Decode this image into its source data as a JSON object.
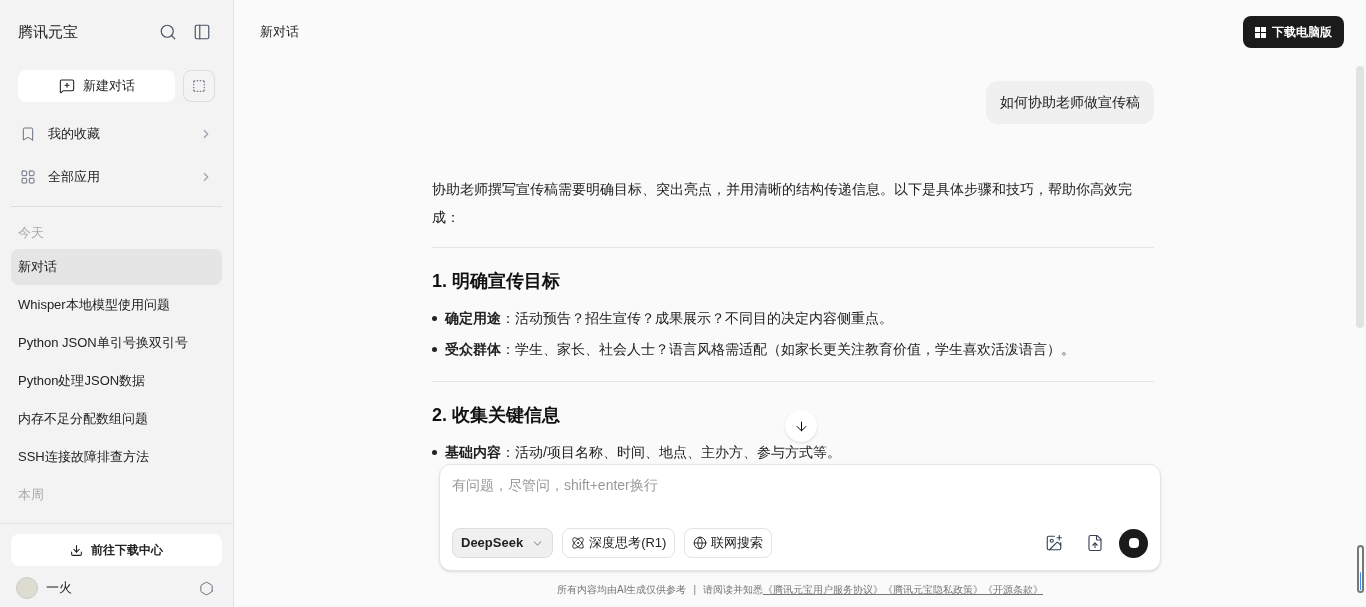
{
  "sidebar": {
    "app_title": "腾讯元宝",
    "new_chat_button": "新建对话",
    "nav_items": [
      {
        "label": "我的收藏",
        "kind": "bookmark"
      },
      {
        "label": "全部应用",
        "kind": "apps"
      }
    ],
    "history_groups": [
      {
        "label": "今天",
        "items": [
          {
            "title": "新对话",
            "selected": true
          },
          {
            "title": "Whisper本地模型使用问题",
            "selected": false
          },
          {
            "title": "Python JSON单引号换双引号",
            "selected": false
          },
          {
            "title": "Python处理JSON数据",
            "selected": false
          },
          {
            "title": "内存不足分配数组问题",
            "selected": false
          },
          {
            "title": "SSH连接故障排查方法",
            "selected": false
          }
        ]
      },
      {
        "label": "本周"
      }
    ],
    "download_center_button": "前往下载中心",
    "user": {
      "name": "一火"
    }
  },
  "header": {
    "title": "新对话",
    "download_button": "下载电脑版"
  },
  "chat": {
    "user_message": "如何协助老师做宣传稿",
    "answer": [
      {
        "kind": "paragraph",
        "text": "协助老师撰写宣传稿需要明确目标、突出亮点，并用清晰的结构传递信息。以下是具体步骤和技巧，帮助你高效完成："
      },
      {
        "kind": "divider"
      },
      {
        "kind": "heading",
        "text": "1. 明确宣传目标"
      },
      {
        "kind": "bullets",
        "items": [
          "**确定用途**：活动预告？招生宣传？成果展示？不同目的决定内容侧重点。",
          "**受众群体**：学生、家长、社会人士？语言风格需适配（如家长更关注教育价值，学生喜欢活泼语言）。"
        ]
      },
      {
        "kind": "divider"
      },
      {
        "kind": "heading",
        "text": "2. 收集关键信息"
      },
      {
        "kind": "bullets",
        "items": [
          "**基础内容**：活动/项目名称、时间、地点、主办方、参与方式等。"
        ]
      }
    ]
  },
  "composer": {
    "placeholder": "有问题，尽管问，shift+enter换行",
    "model": "DeepSeek",
    "toggles": [
      {
        "label": "深度思考(R1)",
        "kind": "think",
        "selected": false
      },
      {
        "label": "联网搜索",
        "kind": "web",
        "selected": false
      }
    ]
  },
  "footer": {
    "notice": "所有内容均由AI生成仅供参考",
    "separator": "|",
    "prefix": "请阅读并知悉",
    "links": [
      "《腾讯元宝用户服务协议》",
      "《腾讯元宝隐私政策》",
      "《开源条款》"
    ]
  }
}
